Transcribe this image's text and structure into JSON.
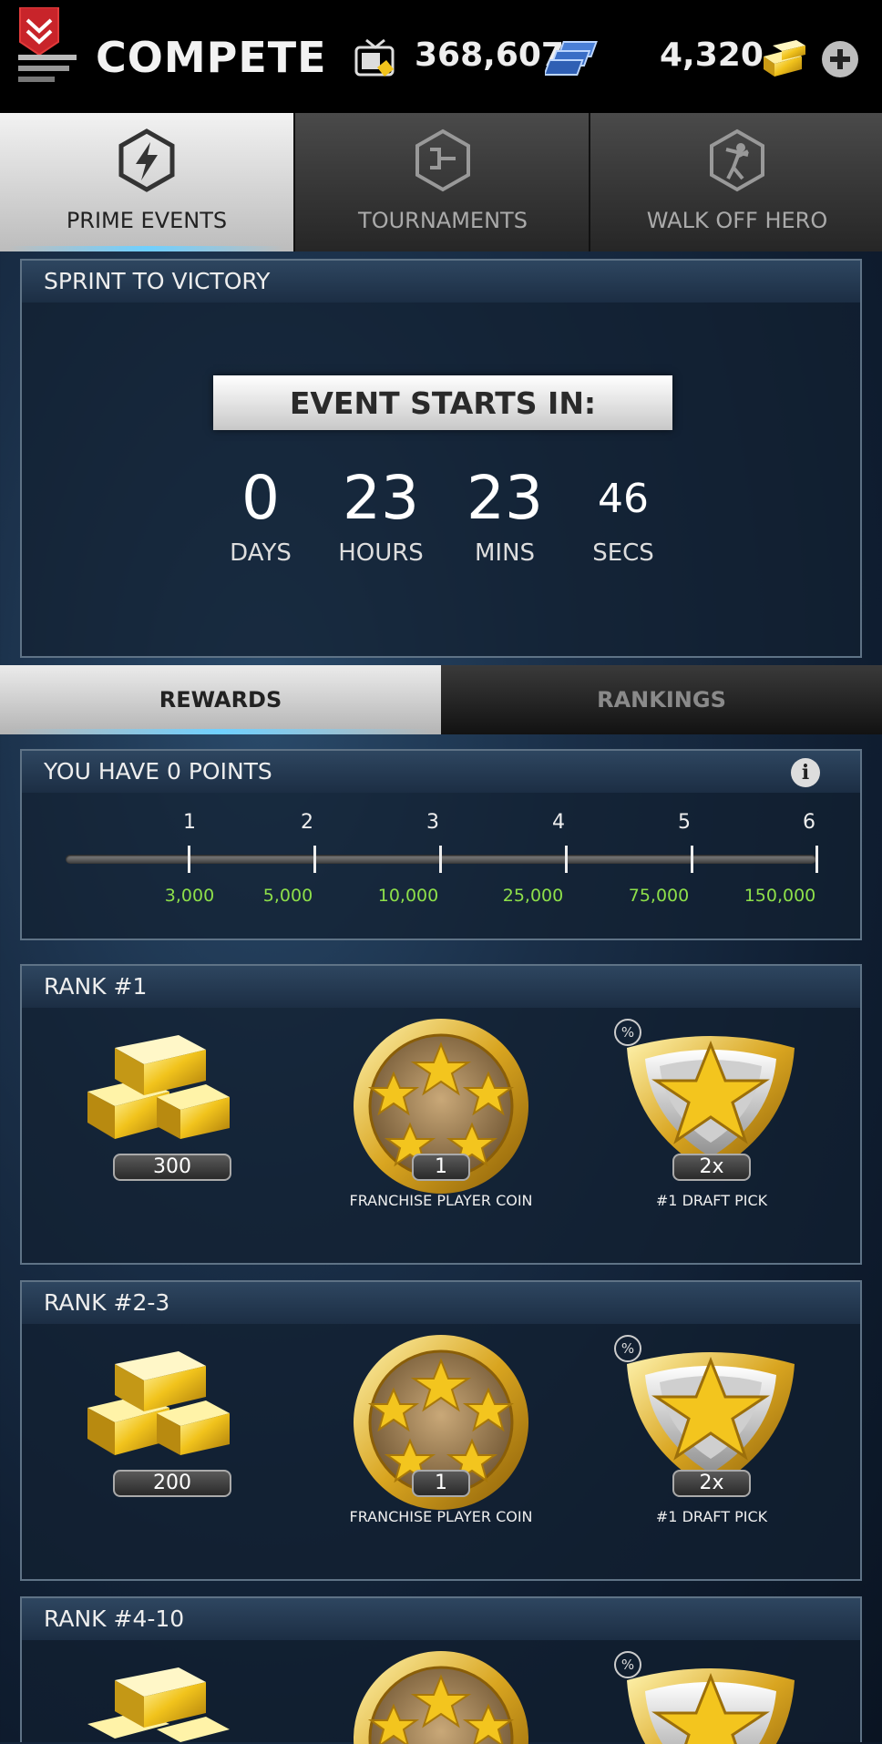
{
  "header": {
    "title": "COMPETE",
    "stubs": "368,607",
    "gold": "4,320"
  },
  "tabs": [
    {
      "label": "PRIME EVENTS",
      "active": true
    },
    {
      "label": "TOURNAMENTS",
      "active": false
    },
    {
      "label": "WALK OFF HERO",
      "active": false
    }
  ],
  "event": {
    "title": "SPRINT TO VICTORY",
    "countdown_label": "EVENT STARTS IN:",
    "days": "0",
    "days_label": "DAYS",
    "hours": "23",
    "hours_label": "HOURS",
    "mins": "23",
    "mins_label": "MINS",
    "secs": "46",
    "secs_label": "SECS"
  },
  "subtabs": [
    {
      "label": "REWARDS",
      "active": true
    },
    {
      "label": "RANKINGS",
      "active": false
    }
  ],
  "points": {
    "title": "YOU HAVE 0 POINTS",
    "tiers": [
      "1",
      "2",
      "3",
      "4",
      "5",
      "6"
    ],
    "thresholds": [
      "3,000",
      "5,000",
      "10,000",
      "25,000",
      "75,000",
      "150,000"
    ]
  },
  "ranks": [
    {
      "title": "RANK #1",
      "gold": "300",
      "coin_qty": "1",
      "coin_label": "FRANCHISE PLAYER COIN",
      "pick_qty": "2x",
      "pick_label": "#1 DRAFT PICK"
    },
    {
      "title": "RANK #2-3",
      "gold": "200",
      "coin_qty": "1",
      "coin_label": "FRANCHISE PLAYER COIN",
      "pick_qty": "2x",
      "pick_label": "#1 DRAFT PICK"
    },
    {
      "title": "RANK #4-10"
    }
  ],
  "colors": {
    "accent_green": "#8ee04a",
    "glow": "#6fd0ff"
  }
}
